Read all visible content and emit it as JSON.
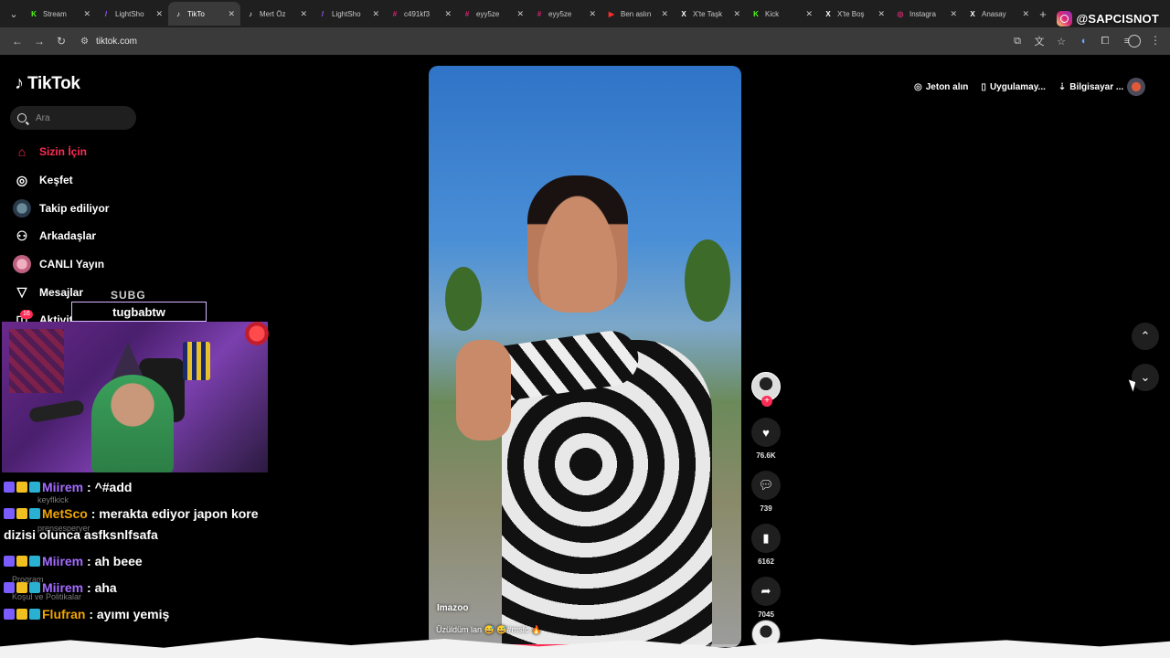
{
  "browser": {
    "tabs": [
      {
        "title": "Stream",
        "color": "#53fc18",
        "glyph": "K"
      },
      {
        "title": "LightSho",
        "color": "#9b59ff",
        "glyph": "/"
      },
      {
        "title": "TikTo",
        "color": "#ffffff",
        "glyph": "♪",
        "active": true
      },
      {
        "title": "Mert Öz",
        "color": "#ffffff",
        "glyph": "♪"
      },
      {
        "title": "LightSho",
        "color": "#9b59ff",
        "glyph": "/"
      },
      {
        "title": "c491kf3",
        "color": "#e0207a",
        "glyph": "#"
      },
      {
        "title": "eyy5ze",
        "color": "#e0207a",
        "glyph": "#"
      },
      {
        "title": "eyy5ze",
        "color": "#e0207a",
        "glyph": "#"
      },
      {
        "title": "Ben aslın",
        "color": "#ff2a2a",
        "glyph": "▶"
      },
      {
        "title": "X'te Taşk",
        "color": "#ffffff",
        "glyph": "X"
      },
      {
        "title": "Kick",
        "color": "#53fc18",
        "glyph": "K"
      },
      {
        "title": "X'te Boş",
        "color": "#ffffff",
        "glyph": "X"
      },
      {
        "title": "Instagra",
        "color": "#d62976",
        "glyph": "◎"
      },
      {
        "title": "Anasay",
        "color": "#ffffff",
        "glyph": "X"
      }
    ],
    "url": "tiktok.com"
  },
  "overlay": {
    "instagram_handle": "@SAPCISNOT",
    "sub_label": "SUBG",
    "streamer_name": "tugbabtw"
  },
  "tiktok": {
    "logo": "TikTok",
    "search_placeholder": "Ara",
    "nav": [
      {
        "label": "Sizin İçin",
        "icon": "home-icon",
        "active": true
      },
      {
        "label": "Keşfet",
        "icon": "compass-icon"
      },
      {
        "label": "Takip ediliyor",
        "icon": "following-avatar"
      },
      {
        "label": "Arkadaşlar",
        "icon": "friends-icon"
      },
      {
        "label": "CANLI Yayın",
        "icon": "live-avatar"
      },
      {
        "label": "Mesajlar",
        "icon": "messages-icon"
      },
      {
        "label": "Aktivite",
        "icon": "activity-icon"
      }
    ],
    "activity_badge": "16",
    "ghost": {
      "user1": "keyflkick",
      "user2": "prensesperyer",
      "program": "Program",
      "kosul": "Koşul ve Politikalar"
    },
    "top_actions": [
      {
        "label": "Jeton alın",
        "icon": "coin-icon"
      },
      {
        "label": "Uygulamay...",
        "icon": "phone-icon"
      },
      {
        "label": "Bilgisayar ...",
        "icon": "download-icon"
      }
    ],
    "video": {
      "author": "Imazoo",
      "caption": "Üzüldüm lan 😅 😅#msfc 🔥",
      "progress": 0.76
    },
    "actions": {
      "likes": "76.6K",
      "comments": "739",
      "saves": "6162",
      "shares": "7045"
    }
  },
  "chat": [
    {
      "user": "Miirem",
      "user_color": "#a46bff",
      "text": ": ^#add"
    },
    {
      "user": "MetSco",
      "user_color": "#f0a500",
      "text": ": merakta ediyor japon kore dizisi olunca asfksnlfsafa"
    },
    {
      "user": "Miirem",
      "user_color": "#a46bff",
      "text": ": ah beee"
    },
    {
      "user": "Miirem",
      "user_color": "#a46bff",
      "text": ": aha"
    },
    {
      "user": "Flufran",
      "user_color": "#f0a500",
      "text": ": ayımı yemiş"
    }
  ]
}
